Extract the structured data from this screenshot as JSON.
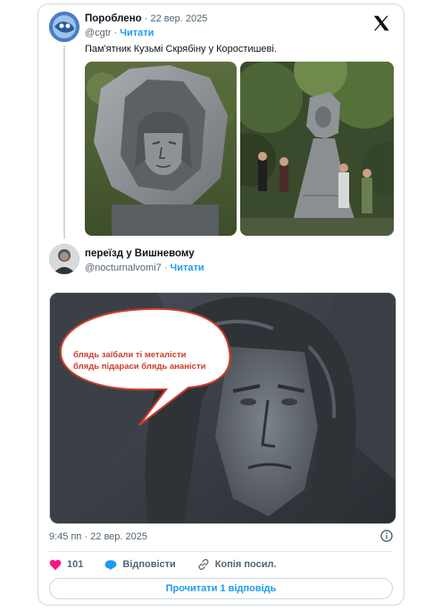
{
  "tweet1": {
    "author": "Пороблено",
    "date": "· 22 вер. 2025",
    "handle": "@cgtr ·",
    "follow": "Читати",
    "text": "Пам'ятник Кузьмі Скрябіну у Коростишеві."
  },
  "tweet2": {
    "author": "переїзд у Вишневому",
    "handle": "@nocturnalvomi7 ·",
    "follow": "Читати",
    "bubble_line1": "блядь заїбали ті металісти",
    "bubble_line2": "блядь підараси блядь ананісти",
    "timestamp": "9:45 пп · 22 вер. 2025",
    "likes_count": "101",
    "reply_label": "Відповісти",
    "copy_label": "Копія посил.",
    "read_replies": "Прочитати 1 відповідь"
  },
  "colors": {
    "accent": "#1d9bf0",
    "like": "#f91880",
    "bubble_text": "#d03a2a"
  },
  "icons": [
    "x-logo-icon",
    "heart-icon",
    "reply-icon",
    "link-icon",
    "info-icon"
  ]
}
